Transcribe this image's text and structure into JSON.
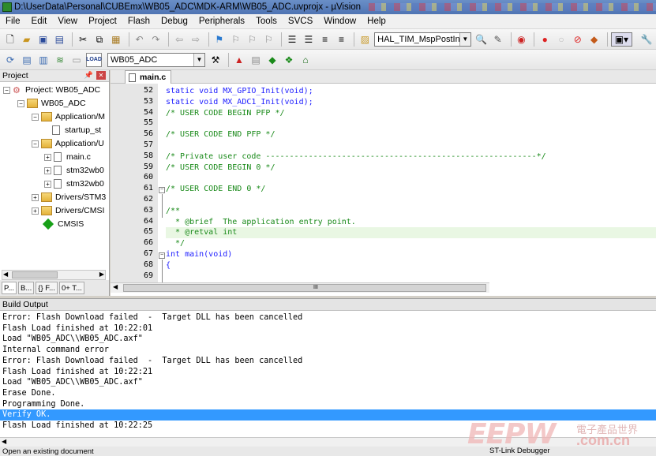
{
  "window": {
    "title": "D:\\UserData\\Personal\\CUBEmx\\WB05_ADC\\MDK-ARM\\WB05_ADC.uvprojx - µVision"
  },
  "menu": [
    "File",
    "Edit",
    "View",
    "Project",
    "Flash",
    "Debug",
    "Peripherals",
    "Tools",
    "SVCS",
    "Window",
    "Help"
  ],
  "toolbar": {
    "function_combo": "HAL_TIM_MspPostInit",
    "target_combo": "WB05_ADC",
    "load_label": "LOAD"
  },
  "project_panel": {
    "title": "Project",
    "tree": [
      "Project: WB05_ADC",
      "WB05_ADC",
      "Application/M",
      "startup_st",
      "Application/U",
      "main.c",
      "stm32wb0",
      "stm32wb0",
      "Drivers/STM3",
      "Drivers/CMSI",
      "CMSIS"
    ],
    "tabs": [
      "P...",
      "B...",
      "{} F...",
      "0+ T..."
    ]
  },
  "editor": {
    "tab": "main.c",
    "lines": [
      {
        "n": "52",
        "t": "static void MX_GPIO_Init(void);"
      },
      {
        "n": "53",
        "t": "static void MX_ADC1_Init(void);"
      },
      {
        "n": "54",
        "t": "/* USER CODE BEGIN PFP */"
      },
      {
        "n": "55",
        "t": ""
      },
      {
        "n": "56",
        "t": "/* USER CODE END PFP */"
      },
      {
        "n": "57",
        "t": ""
      },
      {
        "n": "58",
        "t": "/* Private user code ---------------------------------------------------------*/"
      },
      {
        "n": "59",
        "t": "/* USER CODE BEGIN 0 */"
      },
      {
        "n": "60",
        "t": ""
      },
      {
        "n": "61",
        "t": "/* USER CODE END 0 */"
      },
      {
        "n": "62",
        "t": ""
      },
      {
        "n": "63",
        "t": "/**"
      },
      {
        "n": "64",
        "t": "  * @brief  The application entry point."
      },
      {
        "n": "65",
        "t": "  * @retval int"
      },
      {
        "n": "66",
        "t": "  */"
      },
      {
        "n": "67",
        "t": "int main(void)"
      },
      {
        "n": "68",
        "t": "{"
      },
      {
        "n": "69",
        "t": ""
      }
    ],
    "scroll_grip": "III"
  },
  "build_output": {
    "title": "Build Output",
    "lines": [
      "Error: Flash Download failed  -  Target DLL has been cancelled",
      "Flash Load finished at 10:22:01",
      "Load \"WB05_ADC\\\\WB05_ADC.axf\"",
      "Internal command error",
      "Error: Flash Download failed  -  Target DLL has been cancelled",
      "Flash Load finished at 10:22:21",
      "Load \"WB05_ADC\\\\WB05_ADC.axf\"",
      "Erase Done.",
      "Programming Done.",
      "Verify OK.",
      "Flash Load finished at 10:22:25"
    ],
    "selected_index": 9
  },
  "status": {
    "left": "Open an existing document",
    "right": "ST-Link Debugger"
  },
  "watermark": {
    "logo": "EEPW",
    "cn": "電子產品世界",
    "domain": ".com.cn"
  }
}
